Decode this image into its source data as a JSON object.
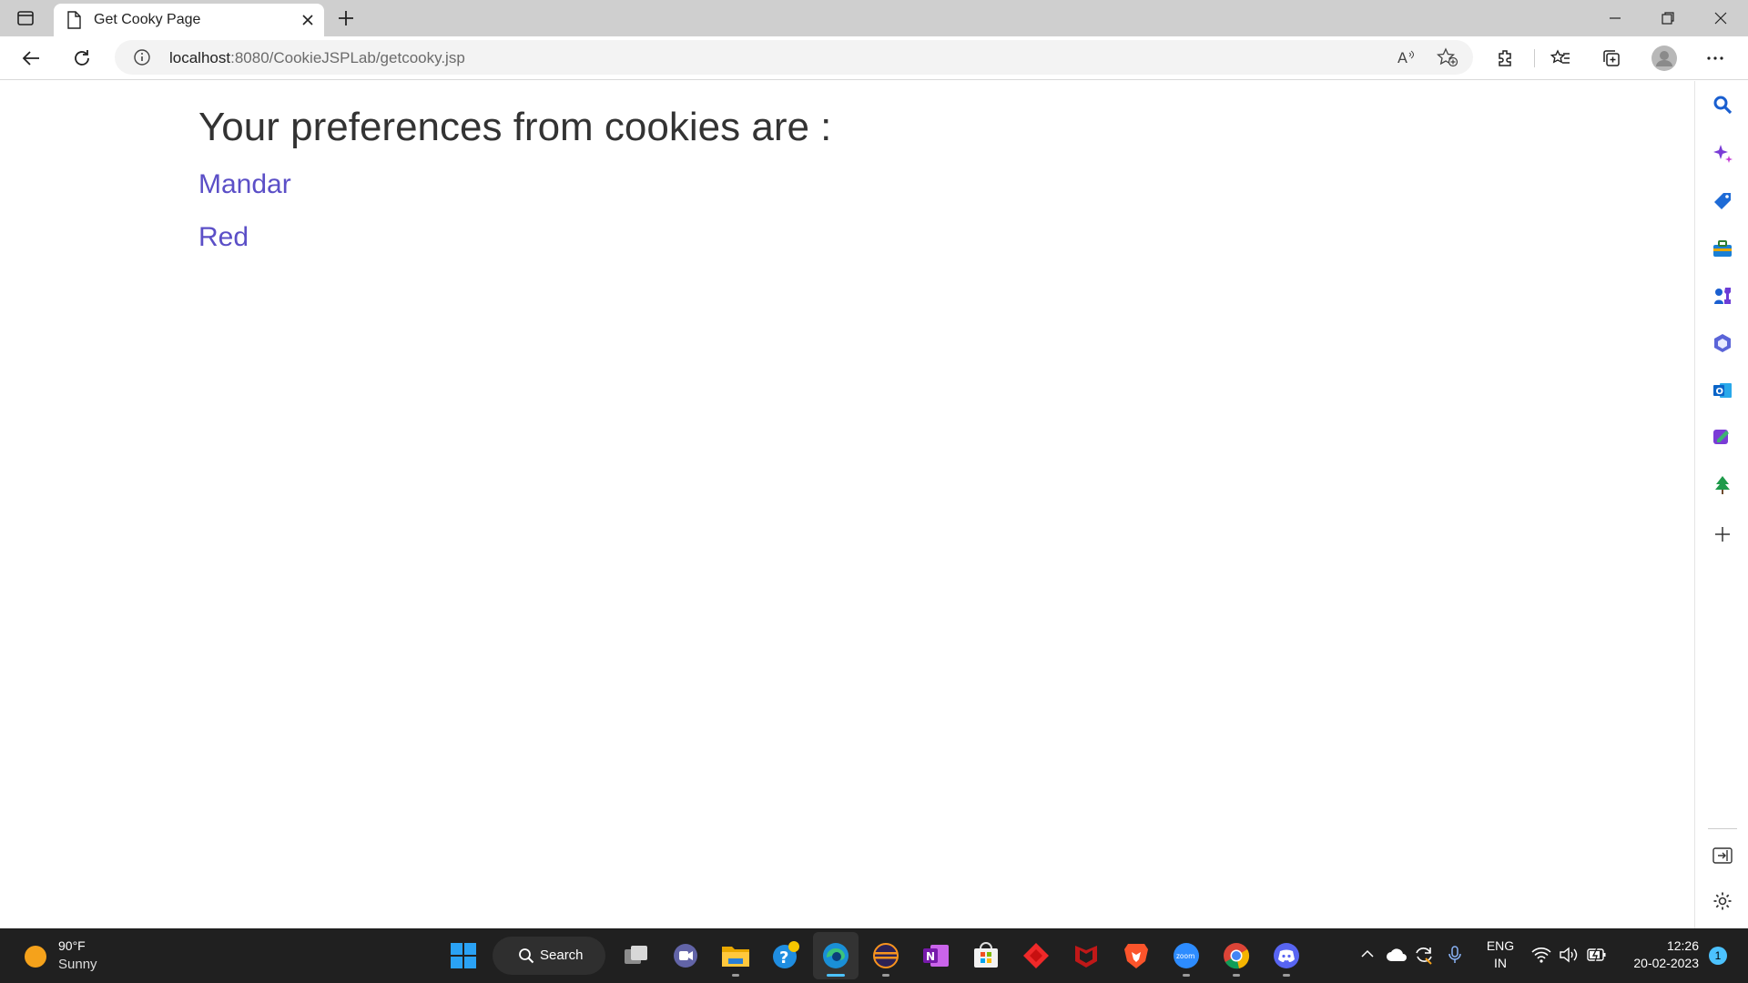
{
  "browser": {
    "tab_title": "Get Cooky Page",
    "url_host": "localhost",
    "url_rest": ":8080/CookieJSPLab/getcooky.jsp"
  },
  "page": {
    "heading": "Your preferences from cookies are :",
    "preferences": [
      "Mandar",
      "Red"
    ]
  },
  "taskbar": {
    "weather_temp": "90°F",
    "weather_desc": "Sunny",
    "search_label": "Search",
    "lang_top": "ENG",
    "lang_bottom": "IN",
    "time": "12:26",
    "date": "20-02-2023",
    "notification_count": "1"
  },
  "colors": {
    "link": "#5b4fc7",
    "taskbar": "#202020",
    "tabstrip": "#cfcfcf"
  }
}
